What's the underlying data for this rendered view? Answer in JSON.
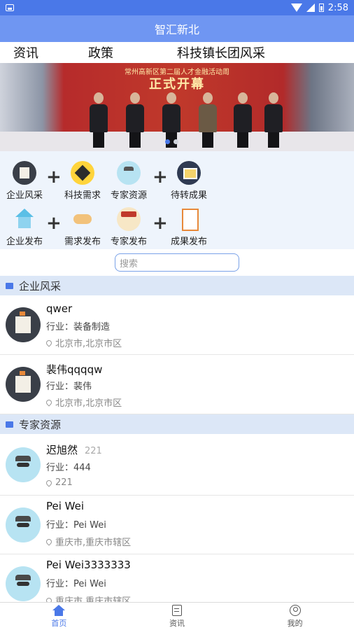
{
  "status_bar": {
    "time": "2:58"
  },
  "app": {
    "title": "智汇新北"
  },
  "top_nav": [
    "资讯",
    "政策",
    "科技镇长团风采"
  ],
  "banner": {
    "subline": "常州高新区第二届人才金融活动周",
    "headline": "正式开幕",
    "active_dot": 0
  },
  "grid": {
    "row1": [
      {
        "label": "企业风采",
        "icon": "castle-icon"
      },
      {
        "label": "科技需求",
        "icon": "handshake-icon"
      },
      {
        "label": "专家资源",
        "icon": "expert-icon"
      },
      {
        "label": "待转成果",
        "icon": "result-icon"
      }
    ],
    "row2": [
      {
        "label": "企业发布",
        "icon": "house-icon"
      },
      {
        "label": "需求发布",
        "icon": "shake-hands-icon"
      },
      {
        "label": "专家发布",
        "icon": "graduate-icon"
      },
      {
        "label": "成果发布",
        "icon": "document-icon"
      }
    ],
    "plus": "+"
  },
  "search": {
    "placeholder": "搜索"
  },
  "sections": {
    "enterprise": {
      "title": "企业风采",
      "items": [
        {
          "name": "qwer",
          "industry": "行业：装备制造",
          "location": "北京市,北京市区"
        },
        {
          "name": "裴伟qqqqw",
          "industry": "行业：裴伟",
          "location": "北京市,北京市区"
        }
      ]
    },
    "experts": {
      "title": "专家资源",
      "items": [
        {
          "name": "迟旭然",
          "extra": "221",
          "industry": "行业：444",
          "location": "221"
        },
        {
          "name": "Pei Wei",
          "extra": "",
          "industry": "行业：Pei Wei",
          "location": "重庆市,重庆市辖区"
        },
        {
          "name": "Pei Wei3333333",
          "extra": "",
          "industry": "行业：Pei Wei",
          "location": "重庆市,重庆市辖区"
        }
      ]
    }
  },
  "tab_bar": [
    {
      "label": "首页",
      "active": true
    },
    {
      "label": "资讯",
      "active": false
    },
    {
      "label": "我的",
      "active": false
    }
  ],
  "colors": {
    "primary": "#4a78e8",
    "title_bar": "#6f96f2",
    "section_bg": "#dce7f7",
    "grid_bg": "#eef4fc"
  }
}
